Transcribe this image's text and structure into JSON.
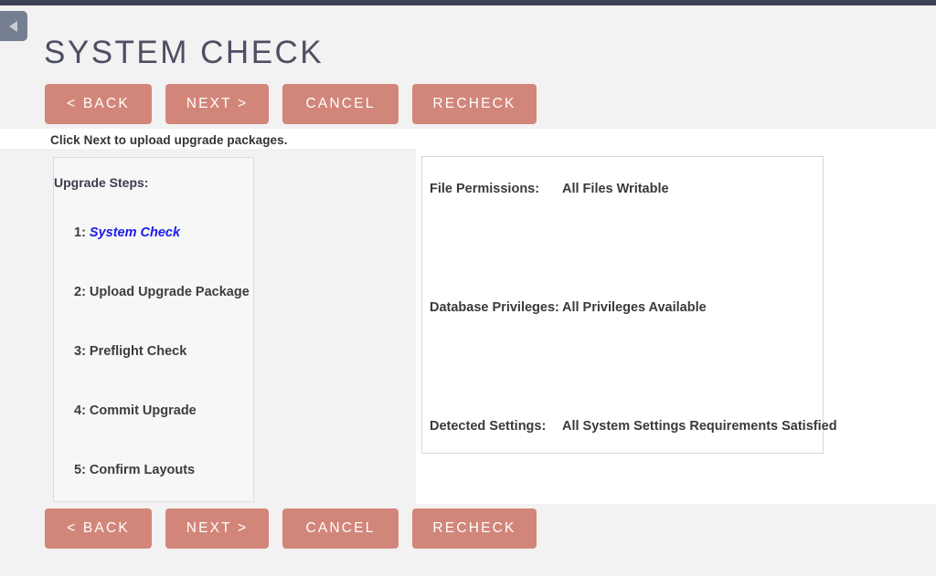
{
  "window": {
    "collapse_tab_icon": "triangle-left-icon",
    "accent_color": "#d2867a",
    "topbar_color": "#3f4156",
    "title_color": "#4d4f63",
    "active_step_color": "#1a1aee"
  },
  "header": {
    "title": "SYSTEM CHECK"
  },
  "toolbar": {
    "back_label": "< BACK",
    "next_label": "NEXT >",
    "cancel_label": "CANCEL",
    "recheck_label": "RECHECK"
  },
  "notice": {
    "text": "Click Next to upload upgrade packages."
  },
  "steps_panel": {
    "title": "Upgrade Steps:",
    "items": [
      {
        "number": "1:",
        "label": "System Check",
        "active": true
      },
      {
        "number": "2:",
        "label": "Upload Upgrade Package",
        "active": false
      },
      {
        "number": "3:",
        "label": "Preflight Check",
        "active": false
      },
      {
        "number": "4:",
        "label": "Commit Upgrade",
        "active": false
      },
      {
        "number": "5:",
        "label": "Confirm Layouts",
        "active": false
      }
    ]
  },
  "results_panel": {
    "rows": [
      {
        "label": "File Permissions:",
        "value": "All Files Writable"
      },
      {
        "label": "Database Privileges:",
        "value": "All Privileges Available"
      },
      {
        "label": "Detected Settings:",
        "value": "All System Settings Requirements Satisfied"
      }
    ]
  },
  "footer_toolbar": {
    "back_label": "< BACK",
    "next_label": "NEXT >",
    "cancel_label": "CANCEL",
    "recheck_label": "RECHECK"
  }
}
